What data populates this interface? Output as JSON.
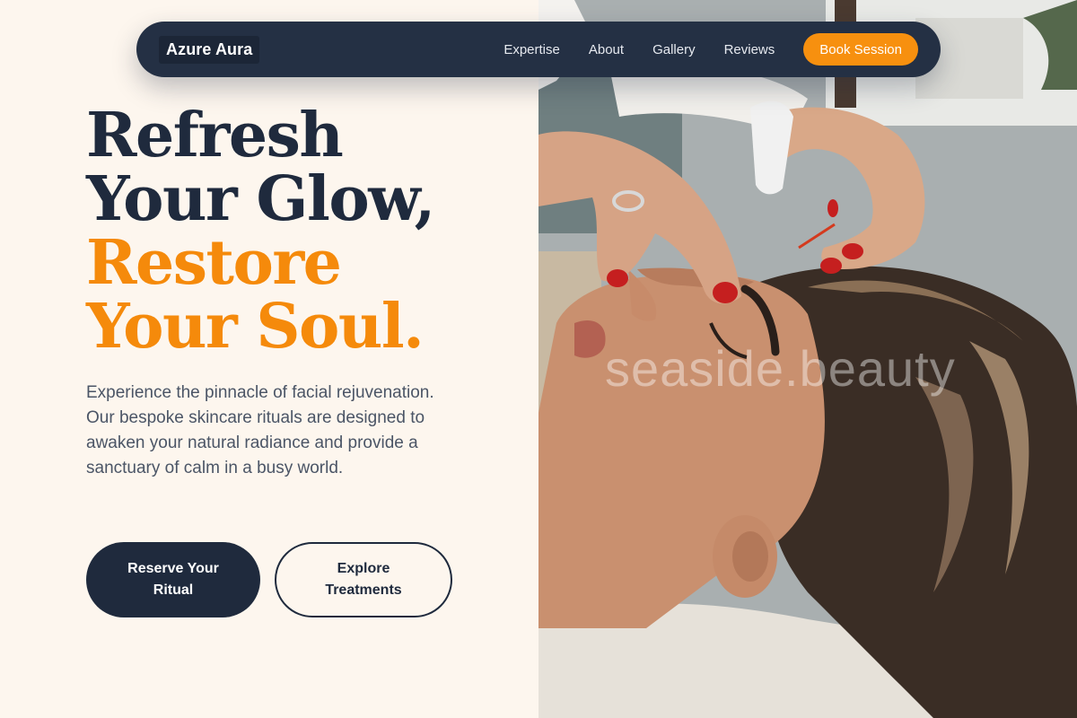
{
  "brand": {
    "name": "Azure Aura"
  },
  "nav": {
    "links": [
      "Expertise",
      "About",
      "Gallery",
      "Reviews"
    ],
    "cta": "Book Session"
  },
  "hero": {
    "line1": "Refresh",
    "line2": "Your Glow,",
    "line3": "Restore",
    "line4": "Your Soul.",
    "description": "Experience the pinnacle of facial rejuvenation. Our bespoke skincare rituals are designed to awaken your natural radiance and provide a sanctuary of calm in a busy world.",
    "primary_button": "Reserve Your Ritual",
    "secondary_button": "Explore Treatments"
  },
  "photo": {
    "watermark": "seaside.beauty"
  },
  "colors": {
    "background": "#fdf6ee",
    "navy": "#1f2a3d",
    "nav_bg": "#243044",
    "accent": "#f58a0b"
  }
}
